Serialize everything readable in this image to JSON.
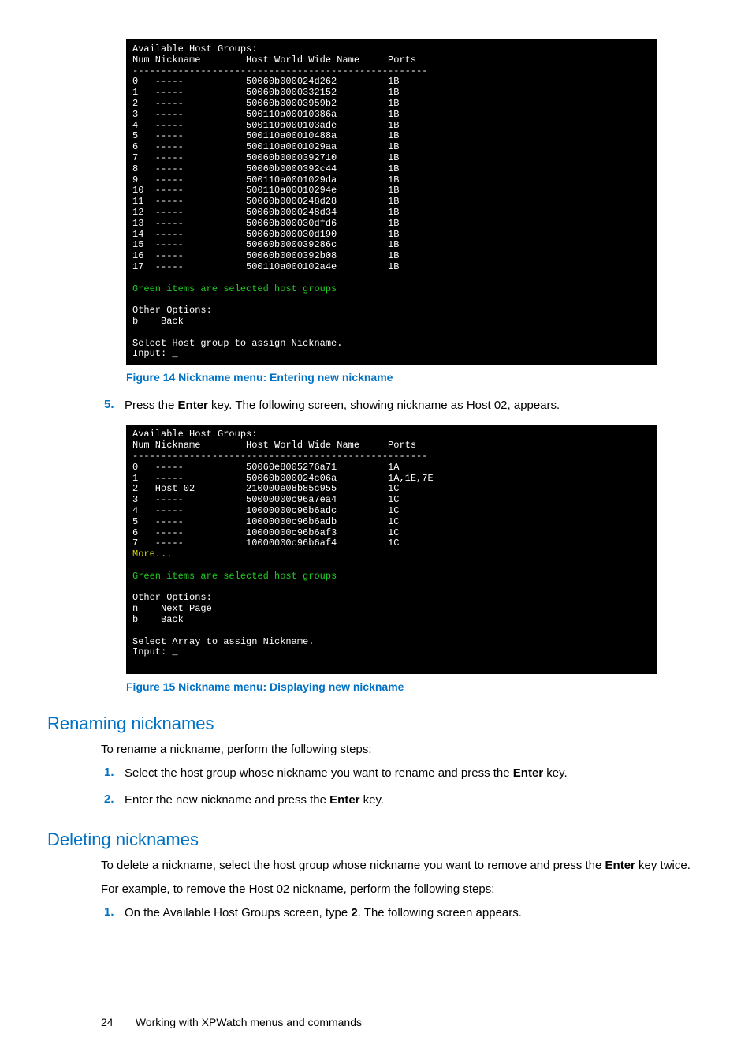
{
  "terminal1": {
    "header": "Available Host Groups:",
    "columns": "Num Nickname        Host World Wide Name     Ports",
    "divider": "----------------------------------------------------",
    "rows": [
      {
        "num": "0",
        "nick": "-----",
        "wwn": "50060b000024d262",
        "ports": "1B"
      },
      {
        "num": "1",
        "nick": "-----",
        "wwn": "50060b0000332152",
        "ports": "1B"
      },
      {
        "num": "2",
        "nick": "-----",
        "wwn": "50060b00003959b2",
        "ports": "1B"
      },
      {
        "num": "3",
        "nick": "-----",
        "wwn": "500110a00010386a",
        "ports": "1B"
      },
      {
        "num": "4",
        "nick": "-----",
        "wwn": "500110a000103ade",
        "ports": "1B"
      },
      {
        "num": "5",
        "nick": "-----",
        "wwn": "500110a00010488a",
        "ports": "1B"
      },
      {
        "num": "6",
        "nick": "-----",
        "wwn": "500110a0001029aa",
        "ports": "1B"
      },
      {
        "num": "7",
        "nick": "-----",
        "wwn": "50060b0000392710",
        "ports": "1B"
      },
      {
        "num": "8",
        "nick": "-----",
        "wwn": "50060b0000392c44",
        "ports": "1B"
      },
      {
        "num": "9",
        "nick": "-----",
        "wwn": "500110a0001029da",
        "ports": "1B"
      },
      {
        "num": "10",
        "nick": "-----",
        "wwn": "500110a00010294e",
        "ports": "1B"
      },
      {
        "num": "11",
        "nick": "-----",
        "wwn": "50060b0000248d28",
        "ports": "1B"
      },
      {
        "num": "12",
        "nick": "-----",
        "wwn": "50060b0000248d34",
        "ports": "1B"
      },
      {
        "num": "13",
        "nick": "-----",
        "wwn": "50060b000030dfd6",
        "ports": "1B"
      },
      {
        "num": "14",
        "nick": "-----",
        "wwn": "50060b000030d190",
        "ports": "1B"
      },
      {
        "num": "15",
        "nick": "-----",
        "wwn": "50060b000039286c",
        "ports": "1B"
      },
      {
        "num": "16",
        "nick": "-----",
        "wwn": "50060b0000392b08",
        "ports": "1B"
      },
      {
        "num": "17",
        "nick": "-----",
        "wwn": "500110a000102a4e",
        "ports": "1B"
      }
    ],
    "green_msg": "Green items are selected host groups",
    "other_options": "Other Options:",
    "opt_b": "b    Back",
    "select_msg": "Select Host group to assign Nickname.",
    "input": "Input: _"
  },
  "caption1": "Figure 14 Nickname menu: Entering new nickname",
  "step5": {
    "num": "5.",
    "text_before": "Press the ",
    "bold1": "Enter",
    "text_after": " key. The following screen, showing nickname as Host 02, appears."
  },
  "terminal2": {
    "header": "Available Host Groups:",
    "columns": "Num Nickname        Host World Wide Name     Ports",
    "divider": "----------------------------------------------------",
    "rows": [
      {
        "num": "0",
        "nick": "-----",
        "wwn": "50060e8005276a71",
        "ports": "1A"
      },
      {
        "num": "1",
        "nick": "-----",
        "wwn": "50060b000024c06a",
        "ports": "1A,1E,7E"
      },
      {
        "num": "2",
        "nick": "Host 02",
        "wwn": "210000e08b85c955",
        "ports": "1C"
      },
      {
        "num": "3",
        "nick": "-----",
        "wwn": "50000000c96a7ea4",
        "ports": "1C"
      },
      {
        "num": "4",
        "nick": "-----",
        "wwn": "10000000c96b6adc",
        "ports": "1C"
      },
      {
        "num": "5",
        "nick": "-----",
        "wwn": "10000000c96b6adb",
        "ports": "1C"
      },
      {
        "num": "6",
        "nick": "-----",
        "wwn": "10000000c96b6af3",
        "ports": "1C"
      },
      {
        "num": "7",
        "nick": "-----",
        "wwn": "10000000c96b6af4",
        "ports": "1C"
      }
    ],
    "more": "More...",
    "green_msg": "Green items are selected host groups",
    "other_options": "Other Options:",
    "opt_n": "n    Next Page",
    "opt_b": "b    Back",
    "select_msg": "Select Array to assign Nickname.",
    "input": "Input: _"
  },
  "caption2": "Figure 15 Nickname menu: Displaying new nickname",
  "section_rename": {
    "title": "Renaming nicknames",
    "intro": "To rename a nickname, perform the following steps:",
    "step1": {
      "num": "1.",
      "t1": "Select the host group whose nickname you want to rename and press the ",
      "b1": "Enter",
      "t2": " key."
    },
    "step2": {
      "num": "2.",
      "t1": "Enter the new nickname and press the ",
      "b1": "Enter",
      "t2": " key."
    }
  },
  "section_delete": {
    "title": "Deleting nicknames",
    "p1": {
      "t1": "To delete a nickname, select the host group whose nickname you want to remove and press the ",
      "b1": "Enter",
      "t2": " key twice."
    },
    "p2": "For example, to remove the Host 02 nickname, perform the following steps:",
    "step1": {
      "num": "1.",
      "t1": "On the Available Host Groups screen, type ",
      "b1": "2",
      "t2": ". The following screen appears."
    }
  },
  "footer": {
    "page": "24",
    "title": "Working with XPWatch menus and commands"
  }
}
